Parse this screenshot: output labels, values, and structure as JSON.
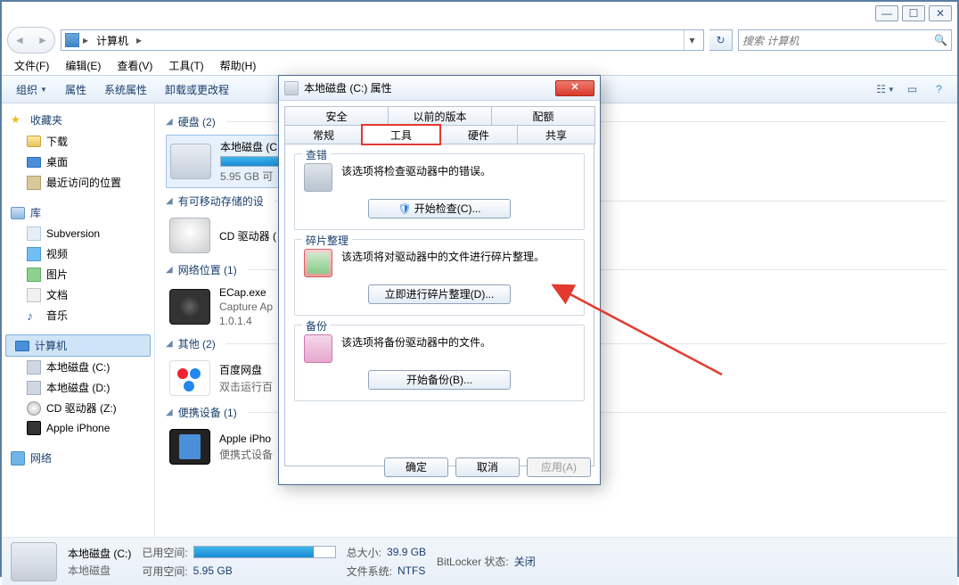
{
  "window_buttons": {
    "min": "—",
    "max": "☐",
    "close": "✕"
  },
  "breadcrumb": {
    "root": "计算机"
  },
  "search": {
    "placeholder": "搜索 计算机"
  },
  "menu": {
    "file": "文件(F)",
    "edit": "编辑(E)",
    "view": "查看(V)",
    "tools": "工具(T)",
    "help": "帮助(H)"
  },
  "toolbar": {
    "organize": "组织",
    "properties": "属性",
    "sysprops": "系统属性",
    "uninstall": "卸载或更改程"
  },
  "sidebar": {
    "favorites": "收藏夹",
    "fav_items": [
      "下载",
      "桌面",
      "最近访问的位置"
    ],
    "library": "库",
    "lib_items": [
      "Subversion",
      "视频",
      "图片",
      "文档",
      "音乐"
    ],
    "computer": "计算机",
    "comp_items": [
      "本地磁盘 (C:)",
      "本地磁盘 (D:)",
      "CD 驱动器 (Z:)",
      "Apple iPhone"
    ],
    "network": "网络"
  },
  "groups": {
    "hdd": "硬盘 (2)",
    "removable": "有可移动存储的设",
    "netloc": "网络位置 (1)",
    "other": "其他 (2)",
    "portable": "便携设备 (1)"
  },
  "driveC": {
    "name": "本地磁盘 (C:",
    "free": "5.95 GB 可"
  },
  "cd": {
    "name": "CD 驱动器 ("
  },
  "ecap": {
    "name": "ECap.exe",
    "sub1": "Capture Ap",
    "sub2": "1.0.1.4"
  },
  "baidu": {
    "name": "百度网盘",
    "sub": "双击运行百"
  },
  "iphone": {
    "name": "Apple iPho",
    "sub": "便携式设备"
  },
  "details": {
    "title": "本地磁盘 (C:)",
    "sub": "本地磁盘",
    "used_k": "已用空间:",
    "free_k": "可用空间:",
    "free_v": "5.95 GB",
    "total_k": "总大小:",
    "total_v": "39.9 GB",
    "fs_k": "文件系统:",
    "fs_v": "NTFS",
    "bitlocker_k": "BitLocker 状态:",
    "bitlocker_v": "关闭"
  },
  "dialog": {
    "title": "本地磁盘 (C:) 属性",
    "tabs_top": [
      "安全",
      "以前的版本",
      "配额"
    ],
    "tabs_bottom": [
      "常规",
      "工具",
      "硬件",
      "共享"
    ],
    "active_tab": "工具",
    "chk_group": "查错",
    "chk_text": "该选项将检查驱动器中的错误。",
    "chk_btn": "开始检查(C)...",
    "def_group": "碎片整理",
    "def_text": "该选项将对驱动器中的文件进行碎片整理。",
    "def_btn": "立即进行碎片整理(D)...",
    "bak_group": "备份",
    "bak_text": "该选项将备份驱动器中的文件。",
    "bak_btn": "开始备份(B)...",
    "ok": "确定",
    "cancel": "取消",
    "apply": "应用(A)"
  }
}
